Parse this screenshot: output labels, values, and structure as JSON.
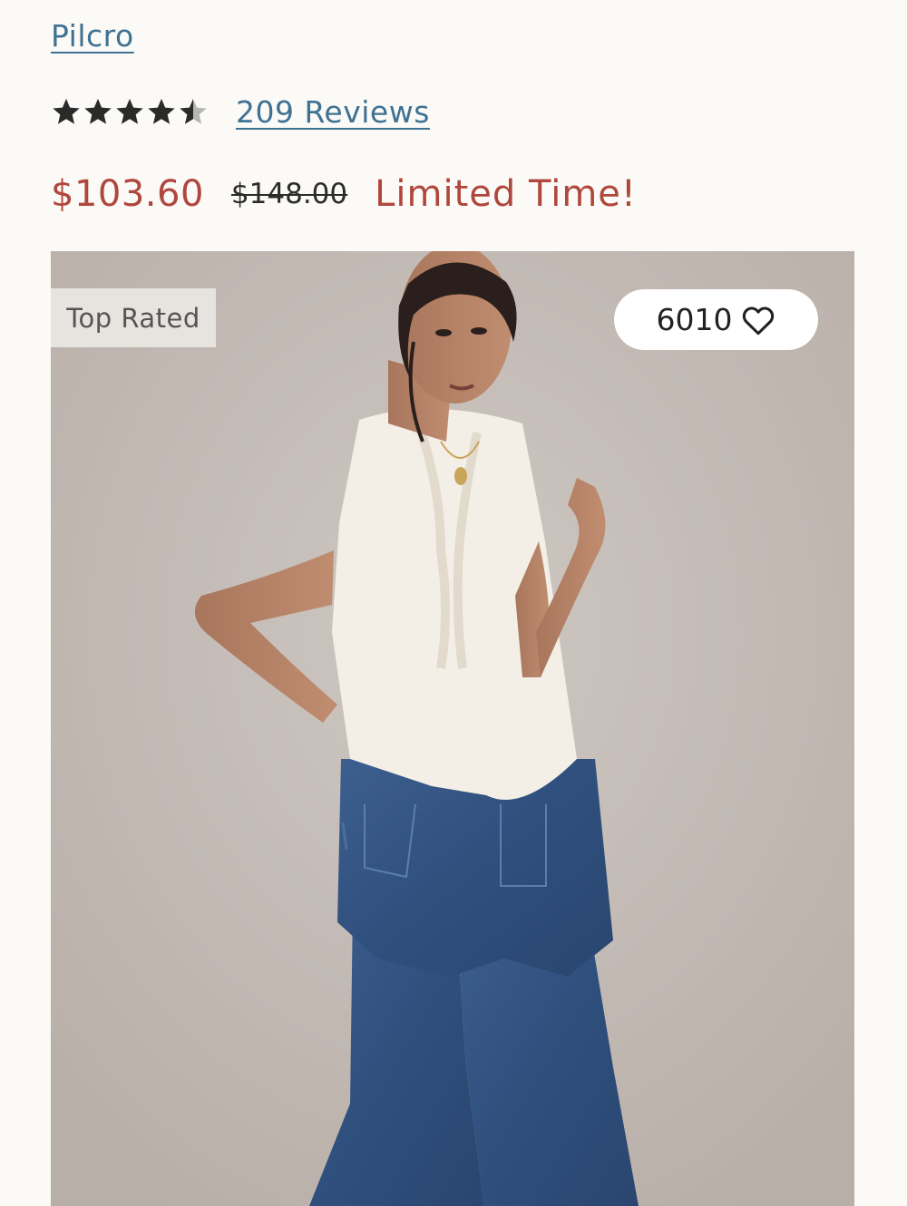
{
  "product": {
    "brand": "Pilcro",
    "rating": 4.5,
    "rating_max": 5,
    "reviews_label": "209 Reviews",
    "price": {
      "sale": "$103.60",
      "original": "$148.00",
      "promo": "Limited Time!"
    },
    "image": {
      "badge": "Top Rated",
      "favorite_count": "6010",
      "favorite_icon": "heart-outline-icon"
    }
  },
  "colors": {
    "link": "#3f7193",
    "sale_price": "#b0473d",
    "page_background": "#fbfaf6",
    "stars": "#2a2a2a",
    "empty_star": "#b5b5b5"
  }
}
